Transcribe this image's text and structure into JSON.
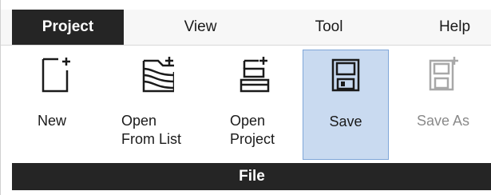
{
  "menu": {
    "items": [
      {
        "label": "Project",
        "active": true
      },
      {
        "label": "View",
        "active": false
      },
      {
        "label": "Tool",
        "active": false
      },
      {
        "label": "Help",
        "active": false
      }
    ]
  },
  "toolbar": {
    "new_label": "New",
    "open_list_line1": "Open",
    "open_list_line2": "From List",
    "open_project_line1": "Open",
    "open_project_line2": "Project",
    "save_label": "Save",
    "save_as_label": "Save As"
  },
  "group": {
    "title": "File"
  },
  "colors": {
    "menu_active_bg": "#252525",
    "selected_bg": "#c9daf0",
    "selected_border": "#7fa6d8",
    "disabled_text": "#8a8a8a"
  }
}
